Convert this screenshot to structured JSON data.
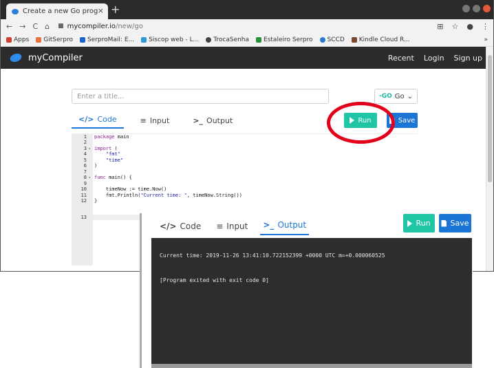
{
  "browser": {
    "tab_title": "Create a new Go program",
    "tab_close": "×",
    "new_tab": "+",
    "nav": {
      "back": "←",
      "forward": "→",
      "reload": "C",
      "home": "⌂"
    },
    "url_host": "mycompiler.io",
    "url_path": "/new/go",
    "right_icons": {
      "translate": "⊞",
      "star": "☆",
      "account": "●",
      "menu": "⋮"
    },
    "bookmarks": [
      {
        "label": "Apps",
        "color": "#d23f31"
      },
      {
        "label": "GitSerpro",
        "color": "#e2733c"
      },
      {
        "label": "SerproMail: E...",
        "color": "#1f63c7"
      },
      {
        "label": "Siscop web - L...",
        "color": "#2e9ad8"
      },
      {
        "label": "TrocaSenha",
        "color": "#444444"
      },
      {
        "label": "Estaleiro Serpro",
        "color": "#2c8f3c"
      },
      {
        "label": "SCCD",
        "color": "#2a7bd0"
      },
      {
        "label": "Kindle Cloud R...",
        "color": "#7a4a2a"
      }
    ],
    "bookmarks_more": "»"
  },
  "app": {
    "brand": "myCompiler",
    "links": {
      "recent": "Recent",
      "login": "Login",
      "signup": "Sign up"
    },
    "title_placeholder": "Enter a title...",
    "language": "Go",
    "language_glyph": "-GO",
    "caret": "⌄",
    "tabs": {
      "code": "Code",
      "code_icon": "</>",
      "input": "Input",
      "input_icon": "≡",
      "output": "Output",
      "output_icon": ">_"
    },
    "run_label": "Run",
    "save_label": "Save"
  },
  "editor": {
    "lines": [
      "1",
      "2",
      "3",
      "4",
      "5",
      "6",
      "7",
      "8",
      "9",
      "10",
      "11",
      "12",
      "13"
    ],
    "fold_marker": "▾",
    "code": {
      "l1a": "package",
      "l1b": " main",
      "l3a": "import",
      "l3b": " (",
      "l4": "    \"fmt\"",
      "l5": "    \"time\"",
      "l6": ")",
      "l8a": "func",
      "l8b": " main() {",
      "l10": "    timeNow := time.Now()",
      "l11a": "    fmt.Println(",
      "l11b": "\"Current time: \"",
      "l11c": ", timeNow.String())",
      "l12": "}"
    }
  },
  "output": {
    "line1": "Current time:  2019-11-26 13:41:10.722152399 +0000 UTC m=+0.000060525",
    "line2": "[Program exited with exit code 0]"
  },
  "colors": {
    "accent": "#1b75d4",
    "run": "#20c5a6",
    "highlight": "#e2001a"
  }
}
